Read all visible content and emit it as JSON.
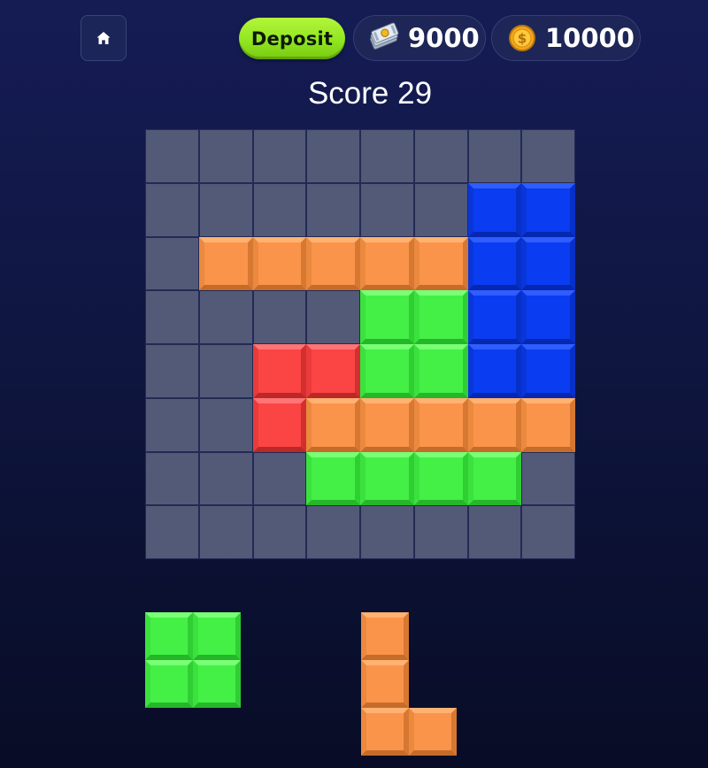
{
  "header": {
    "home_icon": "home-icon",
    "deposit_label": "Deposit",
    "cash": {
      "icon": "money-stack-icon",
      "value": "9000"
    },
    "coins": {
      "icon": "gold-coin-icon",
      "value": "10000"
    }
  },
  "score": {
    "text": "Score 29"
  },
  "colors": {
    "orange": "#fb944b",
    "blue": "#0a3df1",
    "green": "#44f046",
    "red": "#fb4545",
    "empty": "#525a77"
  },
  "board": {
    "rows": 8,
    "cols": 8,
    "grid": [
      [
        ".",
        ".",
        ".",
        ".",
        ".",
        ".",
        ".",
        "."
      ],
      [
        ".",
        ".",
        ".",
        ".",
        ".",
        ".",
        "B",
        "B"
      ],
      [
        ".",
        "O",
        "O",
        "O",
        "O",
        "O",
        "B",
        "B"
      ],
      [
        ".",
        ".",
        ".",
        ".",
        "G",
        "G",
        "B",
        "B"
      ],
      [
        ".",
        ".",
        "R",
        "R",
        "G",
        "G",
        "B",
        "B"
      ],
      [
        ".",
        ".",
        "R",
        "O",
        "O",
        "O",
        "O",
        "O"
      ],
      [
        ".",
        ".",
        ".",
        "G",
        "G",
        "G",
        "G",
        "."
      ],
      [
        ".",
        ".",
        ".",
        ".",
        ".",
        ".",
        ".",
        "."
      ]
    ]
  },
  "tray": [
    {
      "color": "G",
      "cells": [
        [
          0,
          0
        ],
        [
          0,
          1
        ],
        [
          1,
          0
        ],
        [
          1,
          1
        ]
      ]
    },
    {
      "color": "O",
      "cells": [
        [
          0,
          0
        ],
        [
          1,
          0
        ],
        [
          2,
          0
        ],
        [
          2,
          1
        ]
      ]
    }
  ]
}
